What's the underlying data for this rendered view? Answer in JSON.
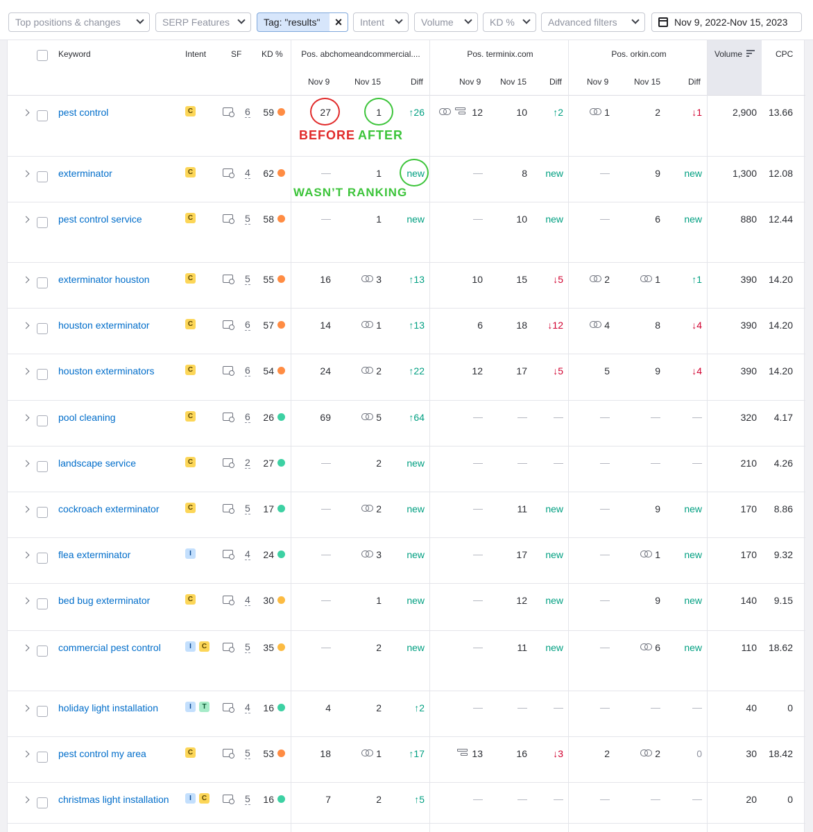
{
  "toolbar": {
    "filters": [
      "Top positions & changes",
      "SERP Features",
      "Intent",
      "Volume",
      "KD %",
      "Advanced filters"
    ],
    "tag_label": "Tag: \"results\"",
    "tag_close": "×",
    "date_range": "Nov 9, 2022-Nov 15, 2023"
  },
  "header": {
    "keyword": "Keyword",
    "intent": "Intent",
    "sf": "SF",
    "kd": "KD %",
    "domains": [
      "Pos. abchomeandcommercial....",
      "Pos. terminix.com",
      "Pos. orkin.com"
    ],
    "sub": [
      "Nov 9",
      "Nov 15",
      "Diff"
    ],
    "volume": "Volume",
    "cpc": "CPC"
  },
  "colors": {
    "kd_high": "#ff8c43",
    "kd_mid": "#fcbb42",
    "kd_low": "#3dd1a3",
    "link_blue": "#006dca",
    "up_green": "#009f81",
    "down_red": "#d1002f",
    "annot_red": "#e12a2a",
    "annot_green": "#3cc43a"
  },
  "rows": [
    {
      "keyword": "pest control",
      "intent": [
        "C"
      ],
      "sf": "6",
      "kd": "59",
      "kd_level": "high",
      "d1": {
        "p1": "27",
        "p2": "1",
        "diff": "26",
        "dir": "up"
      },
      "d2": {
        "p1": "12",
        "p1_icon": "link+snippet",
        "p2": "10",
        "diff": "2",
        "dir": "up"
      },
      "d3": {
        "p1": "1",
        "p1_icon": "link",
        "p2": "2",
        "diff": "1",
        "dir": "down"
      },
      "volume": "2,900",
      "cpc": "13.66"
    },
    {
      "keyword": "exterminator",
      "intent": [
        "C"
      ],
      "sf": "4",
      "kd": "62",
      "kd_level": "high",
      "d1": {
        "p1": "",
        "p2": "1",
        "diff": "new",
        "dir": "new"
      },
      "d2": {
        "p1": "",
        "p2": "8",
        "diff": "new",
        "dir": "new"
      },
      "d3": {
        "p1": "",
        "p2": "9",
        "diff": "new",
        "dir": "new"
      },
      "volume": "1,300",
      "cpc": "12.08"
    },
    {
      "keyword": "pest control service",
      "intent": [
        "C"
      ],
      "sf": "5",
      "kd": "58",
      "kd_level": "high",
      "d1": {
        "p1": "",
        "p2": "1",
        "diff": "new",
        "dir": "new"
      },
      "d2": {
        "p1": "",
        "p2": "10",
        "diff": "new",
        "dir": "new"
      },
      "d3": {
        "p1": "",
        "p2": "6",
        "diff": "new",
        "dir": "new"
      },
      "volume": "880",
      "cpc": "12.44"
    },
    {
      "keyword": "exterminator houston",
      "intent": [
        "C"
      ],
      "sf": "5",
      "kd": "55",
      "kd_level": "high",
      "d1": {
        "p1": "16",
        "p2": "3",
        "p2_icon": "link",
        "diff": "13",
        "dir": "up"
      },
      "d2": {
        "p1": "10",
        "p2": "15",
        "diff": "5",
        "dir": "down"
      },
      "d3": {
        "p1": "2",
        "p1_icon": "link",
        "p2": "1",
        "p2_icon": "link",
        "diff": "1",
        "dir": "up"
      },
      "volume": "390",
      "cpc": "14.20"
    },
    {
      "keyword": "houston exterminator",
      "intent": [
        "C"
      ],
      "sf": "6",
      "kd": "57",
      "kd_level": "high",
      "d1": {
        "p1": "14",
        "p2": "1",
        "p2_icon": "link",
        "diff": "13",
        "dir": "up"
      },
      "d2": {
        "p1": "6",
        "p2": "18",
        "diff": "12",
        "dir": "down"
      },
      "d3": {
        "p1": "4",
        "p1_icon": "link",
        "p2": "8",
        "diff": "4",
        "dir": "down"
      },
      "volume": "390",
      "cpc": "14.20"
    },
    {
      "keyword": "houston exterminators",
      "intent": [
        "C"
      ],
      "sf": "6",
      "kd": "54",
      "kd_level": "high",
      "d1": {
        "p1": "24",
        "p2": "2",
        "p2_icon": "link",
        "diff": "22",
        "dir": "up"
      },
      "d2": {
        "p1": "12",
        "p2": "17",
        "diff": "5",
        "dir": "down"
      },
      "d3": {
        "p1": "5",
        "p2": "9",
        "diff": "4",
        "dir": "down"
      },
      "volume": "390",
      "cpc": "14.20"
    },
    {
      "keyword": "pool cleaning",
      "intent": [
        "C"
      ],
      "sf": "6",
      "kd": "26",
      "kd_level": "low",
      "d1": {
        "p1": "69",
        "p2": "5",
        "p2_icon": "link",
        "diff": "64",
        "dir": "up"
      },
      "d2": {
        "p1": "",
        "p2": "",
        "diff": "",
        "dir": "none"
      },
      "d3": {
        "p1": "",
        "p2": "",
        "diff": "",
        "dir": "none"
      },
      "volume": "320",
      "cpc": "4.17"
    },
    {
      "keyword": "landscape service",
      "intent": [
        "C"
      ],
      "sf": "2",
      "kd": "27",
      "kd_level": "low",
      "d1": {
        "p1": "",
        "p2": "2",
        "diff": "new",
        "dir": "new"
      },
      "d2": {
        "p1": "",
        "p2": "",
        "diff": "",
        "dir": "none"
      },
      "d3": {
        "p1": "",
        "p2": "",
        "diff": "",
        "dir": "none"
      },
      "volume": "210",
      "cpc": "4.26"
    },
    {
      "keyword": "cockroach exterminator",
      "intent": [
        "C"
      ],
      "sf": "5",
      "kd": "17",
      "kd_level": "low",
      "d1": {
        "p1": "",
        "p2": "2",
        "p2_icon": "link",
        "diff": "new",
        "dir": "new"
      },
      "d2": {
        "p1": "",
        "p2": "11",
        "diff": "new",
        "dir": "new"
      },
      "d3": {
        "p1": "",
        "p2": "9",
        "diff": "new",
        "dir": "new"
      },
      "volume": "170",
      "cpc": "8.86"
    },
    {
      "keyword": "flea exterminator",
      "intent": [
        "I"
      ],
      "sf": "4",
      "kd": "24",
      "kd_level": "low",
      "d1": {
        "p1": "",
        "p2": "3",
        "p2_icon": "link",
        "diff": "new",
        "dir": "new"
      },
      "d2": {
        "p1": "",
        "p2": "17",
        "diff": "new",
        "dir": "new"
      },
      "d3": {
        "p1": "",
        "p2": "1",
        "p2_icon": "link",
        "diff": "new",
        "dir": "new"
      },
      "volume": "170",
      "cpc": "9.32"
    },
    {
      "keyword": "bed bug exterminator",
      "intent": [
        "C"
      ],
      "sf": "4",
      "kd": "30",
      "kd_level": "mid",
      "d1": {
        "p1": "",
        "p2": "1",
        "diff": "new",
        "dir": "new"
      },
      "d2": {
        "p1": "",
        "p2": "12",
        "diff": "new",
        "dir": "new"
      },
      "d3": {
        "p1": "",
        "p2": "9",
        "diff": "new",
        "dir": "new"
      },
      "volume": "140",
      "cpc": "9.15"
    },
    {
      "keyword": "commercial pest control",
      "intent": [
        "I",
        "C"
      ],
      "sf": "5",
      "kd": "35",
      "kd_level": "mid",
      "d1": {
        "p1": "",
        "p2": "2",
        "diff": "new",
        "dir": "new"
      },
      "d2": {
        "p1": "",
        "p2": "11",
        "diff": "new",
        "dir": "new"
      },
      "d3": {
        "p1": "",
        "p2": "6",
        "p2_icon": "link",
        "diff": "new",
        "dir": "new"
      },
      "volume": "110",
      "cpc": "18.62"
    },
    {
      "keyword": "holiday light installation",
      "intent": [
        "I",
        "T"
      ],
      "sf": "4",
      "kd": "16",
      "kd_level": "low",
      "d1": {
        "p1": "4",
        "p2": "2",
        "diff": "2",
        "dir": "up"
      },
      "d2": {
        "p1": "",
        "p2": "",
        "diff": "",
        "dir": "none"
      },
      "d3": {
        "p1": "",
        "p2": "",
        "diff": "",
        "dir": "none"
      },
      "volume": "40",
      "cpc": "0"
    },
    {
      "keyword": "pest control my area",
      "intent": [
        "C"
      ],
      "sf": "5",
      "kd": "53",
      "kd_level": "high",
      "d1": {
        "p1": "18",
        "p2": "1",
        "p2_icon": "link",
        "diff": "17",
        "dir": "up"
      },
      "d2": {
        "p1": "13",
        "p1_icon": "snippet",
        "p2": "16",
        "diff": "3",
        "dir": "down"
      },
      "d3": {
        "p1": "2",
        "p2": "2",
        "p2_icon": "link",
        "diff": "0",
        "dir": "zero"
      },
      "volume": "30",
      "cpc": "18.42"
    },
    {
      "keyword": "christmas light installation",
      "intent": [
        "I",
        "C"
      ],
      "sf": "5",
      "kd": "16",
      "kd_level": "low",
      "d1": {
        "p1": "7",
        "p2": "2",
        "diff": "5",
        "dir": "up"
      },
      "d2": {
        "p1": "",
        "p2": "",
        "diff": "",
        "dir": "none"
      },
      "d3": {
        "p1": "",
        "p2": "",
        "diff": "",
        "dir": "none"
      },
      "volume": "20",
      "cpc": "0"
    }
  ],
  "annotations": {
    "before": "BEFORE",
    "after": "AFTER",
    "wasnt_ranking": "WASN’T RANKING"
  }
}
